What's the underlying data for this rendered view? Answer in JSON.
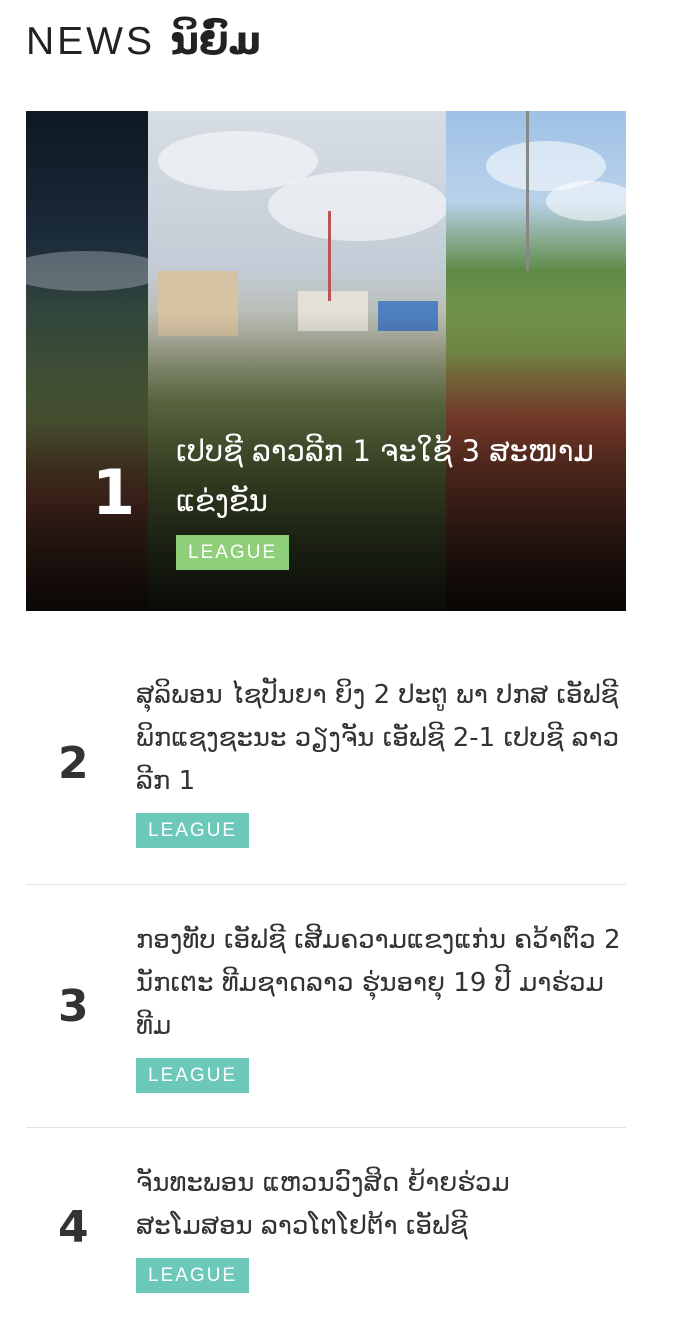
{
  "header": {
    "title_en": "NEWS",
    "title_lo": "ນິຍົມ"
  },
  "featured": {
    "rank": "1",
    "title": "ເປບຊີ ລາວລີກ 1 ຈະໃຊ້ 3 ສະໜາມແຂ່ງຂັນ",
    "badge": "LEAGUE",
    "badge_color": "#8fcf7a"
  },
  "list": [
    {
      "rank": "2",
      "title": "ສຸລິພອນ ໄຊປັນຍາ ຍິງ 2 ປະຕູ ພາ ປກສ ເອັຟຊີ ພິກແຊງຊະນະ ວຽງຈັນ ເອັຟຊີ 2-1 ເປບຊີ ລາວລີກ 1",
      "badge": "LEAGUE"
    },
    {
      "rank": "3",
      "title": "ກອງທັບ ເອັຟຊີ ເສີມຄວາມແຂງແກ່ນ ຄວ້າຕົວ 2 ນັກເຕະ ທີມຊາດລາວ ຮຸ່ນອາຍຸ 19 ປີ ມາຮ່ວມທີມ",
      "badge": "LEAGUE"
    },
    {
      "rank": "4",
      "title": "ຈັນທະພອນ ແຫວນວົງສິດ ຍ້າຍຮ່ວມ ສະໂມສອນ ລາວໂຕໂຢຕ້າ ເອັຟຊີ",
      "badge": "LEAGUE"
    }
  ],
  "colors": {
    "list_badge": "#6cc9b9",
    "featured_badge": "#8fcf7a"
  }
}
